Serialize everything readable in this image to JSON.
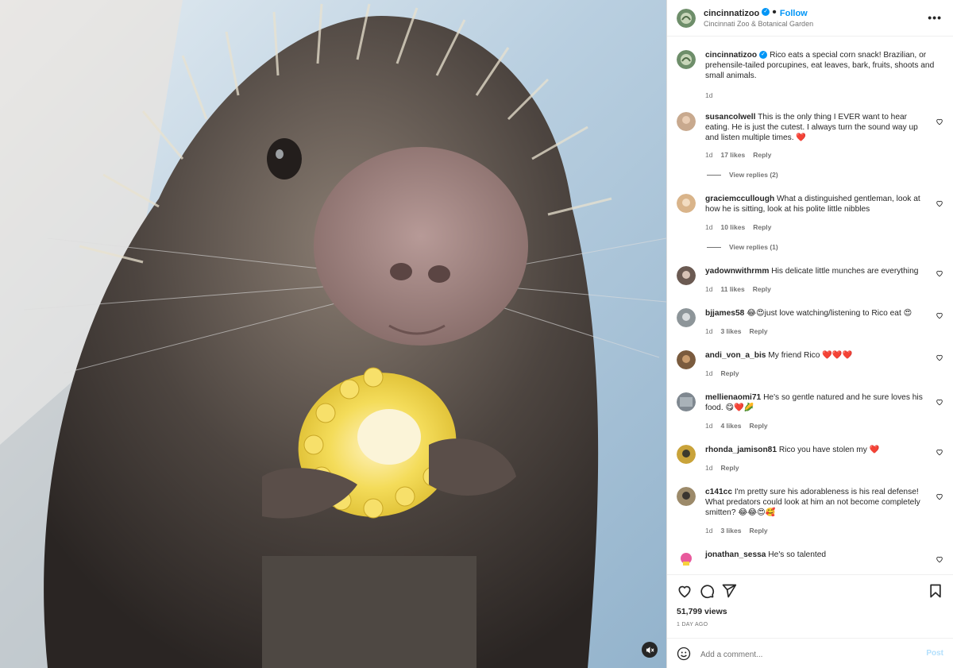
{
  "header": {
    "username": "cincinnatizoo",
    "follow_label": "Follow",
    "location": "Cincinnati Zoo & Botanical Garden",
    "more_label": "•••"
  },
  "caption": {
    "username": "cincinnatizoo",
    "text": "Rico eats a special corn snack! Brazilian, or prehensile-tailed porcupines, eat leaves, bark, fruits, shoots and small animals.",
    "time": "1d"
  },
  "comments": [
    {
      "username": "susancolwell",
      "text": "This is the only thing I EVER want to hear eating. He is just the cutest. I always turn the sound way up and listen multiple times. ❤️",
      "time": "1d",
      "likes": "17 likes",
      "reply": "Reply",
      "view_replies": "View replies (2)",
      "avatar_color": "#c8a98e"
    },
    {
      "username": "graciemccullough",
      "text": "What a distinguished gentleman, look at how he is sitting, look at his polite little nibbles",
      "time": "1d",
      "likes": "10 likes",
      "reply": "Reply",
      "view_replies": "View replies (1)",
      "avatar_color": "#d9b48a"
    },
    {
      "username": "yadownwithrmm",
      "text": "His delicate little munches are everything",
      "time": "1d",
      "likes": "11 likes",
      "reply": "Reply",
      "avatar_color": "#6b5a52"
    },
    {
      "username": "bjjames58",
      "text": "😂😍just love watching/listening to Rico eat 😍",
      "time": "1d",
      "likes": "3 likes",
      "reply": "Reply",
      "avatar_color": "#8d9599"
    },
    {
      "username": "andi_von_a_bis",
      "text": "My friend Rico ❤️❤️❤️",
      "time": "1d",
      "likes": "",
      "reply": "Reply",
      "avatar_color": "#7a5b3e"
    },
    {
      "username": "mellienaomi71",
      "text": "He's so gentle natured and he sure loves his food. 😋❤️🌽",
      "time": "1d",
      "likes": "4 likes",
      "reply": "Reply",
      "avatar_color": "#7f8890"
    },
    {
      "username": "rhonda_jamison81",
      "text": "Rico you have stolen my ❤️",
      "time": "1d",
      "likes": "",
      "reply": "Reply",
      "avatar_color": "#c9a33a"
    },
    {
      "username": "c141cc",
      "text": "I'm pretty sure his adorableness is his real defense! What predators could look at him an not become completely smitten? 😂😂😍🥰",
      "time": "1d",
      "likes": "3 likes",
      "reply": "Reply",
      "avatar_color": "#9c8a6a"
    },
    {
      "username": "jonathan_sessa",
      "text": "He's so talented",
      "time": "",
      "likes": "",
      "reply": "",
      "avatar_color": "#e85a9c"
    }
  ],
  "stats": {
    "views": "51,799 views",
    "posted": "1 DAY AGO"
  },
  "add_comment": {
    "placeholder": "Add a comment...",
    "post_label": "Post"
  },
  "colors": {
    "accent": "#0095f6",
    "verified": "#0095f6",
    "muted_text": "#737373",
    "post_disabled": "#b2dffc"
  },
  "icons": [
    "verified-badge-icon",
    "more-options-icon",
    "heart-icon",
    "comment-icon",
    "share-icon",
    "bookmark-icon",
    "emoji-icon",
    "mute-icon"
  ]
}
